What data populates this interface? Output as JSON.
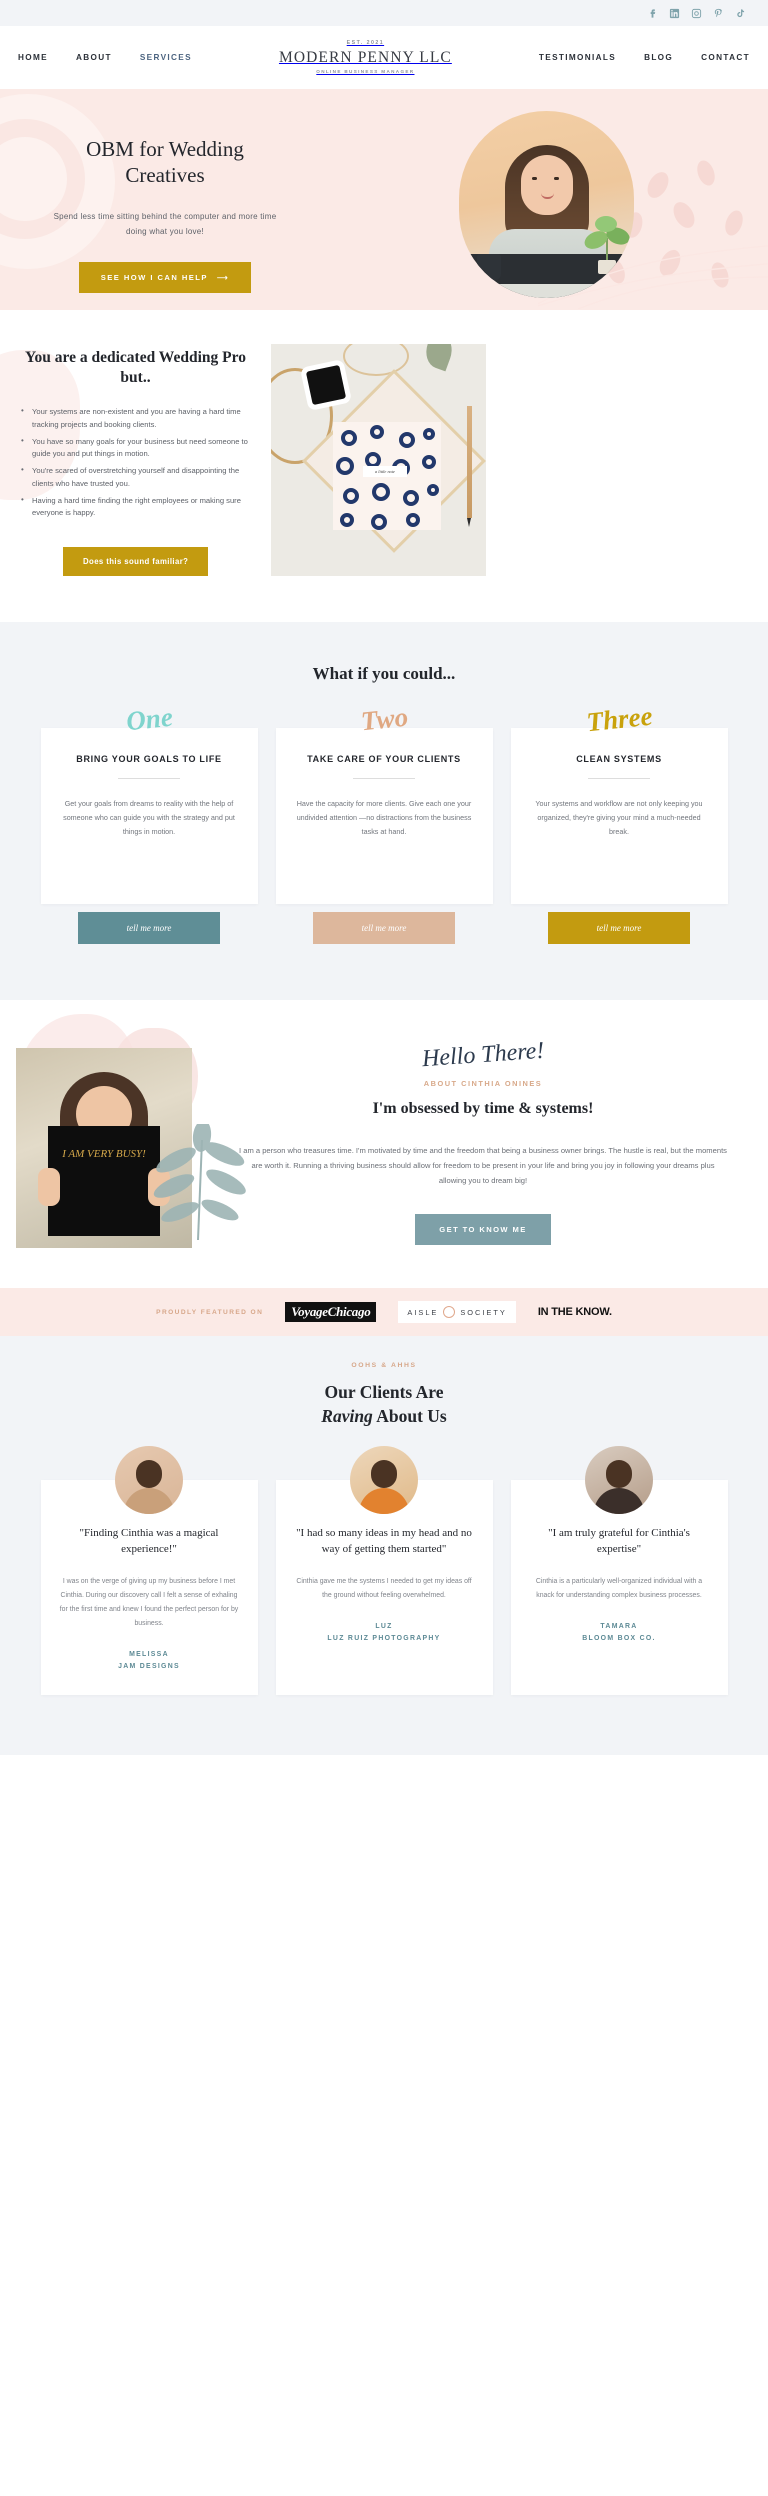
{
  "topbar": {
    "socials": [
      {
        "name": "facebook-icon",
        "glyph": "f"
      },
      {
        "name": "linkedin-icon",
        "glyph": "in"
      },
      {
        "name": "instagram-icon",
        "glyph": "◻"
      },
      {
        "name": "pinterest-icon",
        "glyph": "P"
      },
      {
        "name": "tiktok-icon",
        "glyph": "♪"
      }
    ]
  },
  "nav": {
    "left": [
      "HOME",
      "ABOUT",
      "SERVICES"
    ],
    "right": [
      "TESTIMONIALS",
      "BLOG",
      "CONTACT"
    ],
    "logo": {
      "est": "EST. 2021",
      "name": "MODERN PENNY LLC",
      "sub": "ONLINE BUSINESS MANAGER"
    }
  },
  "hero": {
    "heading": "OBM for Wedding Creatives",
    "paragraph": "Spend less time sitting behind the computer and more time doing what you love!",
    "cta": "SEE HOW I CAN HELP",
    "cta_arrow": "⟶"
  },
  "pro": {
    "heading": "You are a dedicated Wedding Pro but..",
    "bullets": [
      "Your systems are non-existent and you are having a hard time tracking projects and booking clients.",
      "You have so many goals for your business but need someone to guide you and put things in motion.",
      "You're scared of overstretching yourself and disappointing the clients who have trusted you.",
      "Having a hard time finding the right employees or making sure everyone is happy."
    ],
    "cta": "Does this sound familiar?",
    "image_note": "a little note"
  },
  "whatif": {
    "heading": "What if you could...",
    "cards": [
      {
        "script": "One",
        "script_color": "#7fd4cd",
        "title": "BRING YOUR GOALS TO LIFE",
        "body": "Get your goals from dreams to reality with the help of someone who can guide you with the strategy and put things in motion.",
        "cta": "tell me more",
        "cta_color": "#5f8e96"
      },
      {
        "script": "Two",
        "script_color": "#e0a882",
        "title": "TAKE CARE OF YOUR CLIENTS",
        "body": "Have the capacity for more clients. Give each one your undivided attention —no distractions from the business tasks at hand.",
        "cta": "tell me more",
        "cta_color": "#ddb79c"
      },
      {
        "script": "Three",
        "script_color": "#c9a20c",
        "title": "CLEAN SYSTEMS",
        "body": "Your systems and workflow are not only keeping you organized, they're giving your mind a much-needed break.",
        "cta": "tell me more",
        "cta_color": "#c39b10"
      }
    ]
  },
  "about": {
    "script": "Hello There!",
    "kicker": "ABOUT CINTHIA ONINES",
    "heading": "I'm obsessed by time & systems!",
    "paragraph": "I am a person who treasures time. I'm motivated by time and the freedom that being a business owner brings. The hustle is real, but the moments are worth it. Running a thriving business should allow for freedom to be present in your life and bring you joy in following your dreams plus allowing you to dream big!",
    "cta": "GET TO KNOW ME",
    "book_text": "I AM VERY BUSY!"
  },
  "featured": {
    "label": "PROUDLY FEATURED ON",
    "logos": [
      {
        "name": "voyagechicago-logo",
        "text": "VoyageChicago"
      },
      {
        "name": "aisle-society-logo",
        "left": "AISLE",
        "right": "SOCIETY"
      },
      {
        "name": "in-the-know-logo",
        "text": "IN THE KNOW."
      }
    ]
  },
  "testimonials": {
    "kicker": "OOHS & AHHS",
    "heading_line1": "Our Clients Are",
    "heading_italic": "Raving",
    "heading_line2_rest": " About Us",
    "cards": [
      {
        "quote": "\"Finding Cinthia was a magical experience!\"",
        "body": "I was on the verge of giving up my business before I met Cinthia. During our discovery call I felt a sense of exhaling for the first time and knew I found the perfect person for by business.",
        "name": "MELISSA",
        "company": "JAM DESIGNS"
      },
      {
        "quote": "\"I had so many ideas in my head and no way of getting them started\"",
        "body": "Cinthia gave me the systems I needed to get my ideas off the ground without feeling overwhelmed.",
        "name": "LUZ",
        "company": "LUZ RUIZ PHOTOGRAPHY"
      },
      {
        "quote": "\"I am truly grateful for Cinthia's expertise\"",
        "body": "Cinthia is a particularly well-organized individual with a knack for understanding complex business processes.",
        "name": "TAMARA",
        "company": "BLOOM BOX CO."
      }
    ]
  },
  "colors": {
    "gold": "#c39b10",
    "teal": "#7ea0a8",
    "blush": "#fbeae6",
    "grey_bg": "#f2f4f7",
    "peach": "#d8a98a"
  }
}
